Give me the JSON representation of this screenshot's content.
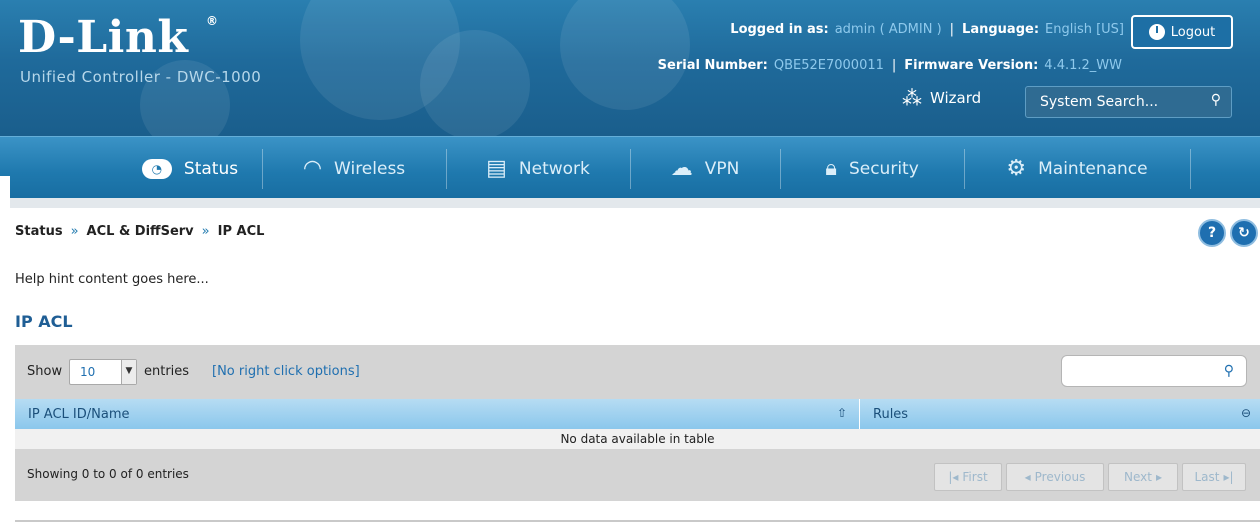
{
  "brand": {
    "logo_text": "D-Link",
    "registered_mark": "®",
    "product_name": "Unified Controller - DWC-1000"
  },
  "header": {
    "logged_in_label": "Logged in as:",
    "logged_in_value": "admin ( ADMIN )",
    "language_label": "Language:",
    "language_value": "English [US]",
    "serial_label": "Serial Number:",
    "serial_value": "QBE52E7000011",
    "firmware_label": "Firmware Version:",
    "firmware_value": "4.4.1.2_WW",
    "logout_label": "Logout",
    "wizard_label": "Wizard",
    "search_placeholder": "System Search..."
  },
  "nav": {
    "items": [
      {
        "label": "Status",
        "icon": "status-icon"
      },
      {
        "label": "Wireless",
        "icon": "wifi-icon"
      },
      {
        "label": "Network",
        "icon": "network-icon"
      },
      {
        "label": "VPN",
        "icon": "vpn-cloud-icon"
      },
      {
        "label": "Security",
        "icon": "lock-icon"
      },
      {
        "label": "Maintenance",
        "icon": "gears-icon"
      }
    ],
    "active": "Status"
  },
  "breadcrumb": [
    "Status",
    "ACL & DiffServ",
    "IP ACL"
  ],
  "breadcrumb_separator": "»",
  "hint": "Help hint content goes here...",
  "section_title": "IP ACL",
  "table": {
    "show_label": "Show",
    "page_length": "10",
    "entries_label": "entries",
    "right_click_note": "[No right click options]",
    "columns": [
      "IP ACL ID/Name",
      "Rules"
    ],
    "empty_message": "No data available in table",
    "info": "Showing 0 to 0 of 0 entries",
    "pagination": {
      "first": "First",
      "previous": "Previous",
      "next": "Next",
      "last": "Last"
    }
  },
  "colors": {
    "header_blue": "#1f6a9b",
    "nav_blue": "#1f79ae",
    "accent_text": "#8ec9ec",
    "table_header": "#8bc7ec",
    "toolbar_gray": "#d4d4d4"
  }
}
